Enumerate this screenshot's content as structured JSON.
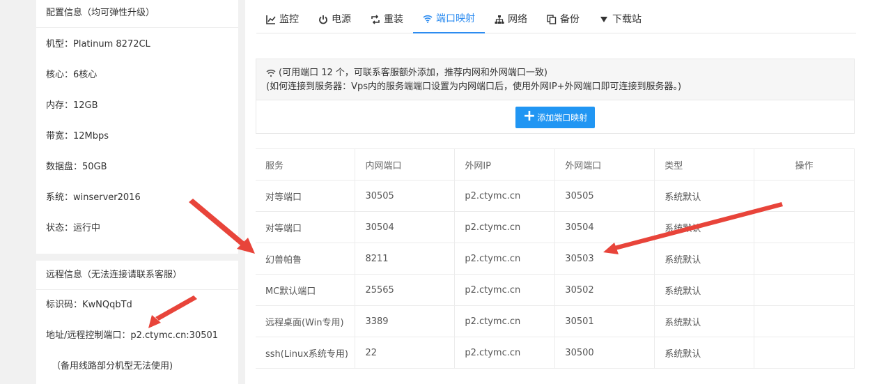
{
  "config": {
    "title": "配置信息（均可弹性升级）",
    "items": [
      "机型：Platinum 8272CL",
      "核心：6核心",
      "内存：12GB",
      "带宽：12Mbps",
      "数据盘：50GB",
      "系统：winserver2016",
      "状态：运行中"
    ]
  },
  "remote": {
    "title": "远程信息（无法连接请联系客服）",
    "id_line": "标识码：KwNQqbTd",
    "addr_line": "地址/远程控制端口：p2.ctymc.cn:30501",
    "note": "（备用线路部分机型无法使用)"
  },
  "tabs": [
    {
      "label": "监控",
      "icon": "chart-line-icon"
    },
    {
      "label": "电源",
      "icon": "power-icon"
    },
    {
      "label": "重装",
      "icon": "retweet-icon"
    },
    {
      "label": "端口映射",
      "icon": "wifi-icon",
      "active": true
    },
    {
      "label": "网络",
      "icon": "sitemap-icon"
    },
    {
      "label": "备份",
      "icon": "copy-icon"
    },
    {
      "label": "下载站",
      "icon": "caret-down-icon"
    }
  ],
  "info": {
    "line1": "(可用端口 12 个，可联系客服额外添加，推荐内网和外网端口一致)",
    "line2": "(如何连接到服务器：Vps内的服务端端口设置为内网端口后，使用外网IP+外网端口即可连接到服务器。)",
    "add_button": "添加端口映射"
  },
  "table": {
    "headers": [
      "服务",
      "内网端口",
      "外网IP",
      "外网端口",
      "类型",
      "操作"
    ],
    "rows": [
      [
        "对等端口",
        "30505",
        "p2.ctymc.cn",
        "30505",
        "系统默认",
        ""
      ],
      [
        "对等端口",
        "30504",
        "p2.ctymc.cn",
        "30504",
        "系统默认",
        ""
      ],
      [
        "幻兽帕鲁",
        "8211",
        "p2.ctymc.cn",
        "30503",
        "系统默认",
        ""
      ],
      [
        "MC默认端口",
        "25565",
        "p2.ctymc.cn",
        "30502",
        "系统默认",
        ""
      ],
      [
        "远程桌面(Win专用)",
        "3389",
        "p2.ctymc.cn",
        "30501",
        "系统默认",
        ""
      ],
      [
        "ssh(Linux系统专用)",
        "22",
        "p2.ctymc.cn",
        "30500",
        "系统默认",
        ""
      ]
    ]
  },
  "colors": {
    "accent": "#2d8cf0",
    "button": "#2196f3",
    "annotation_arrow": "#e8443a"
  }
}
